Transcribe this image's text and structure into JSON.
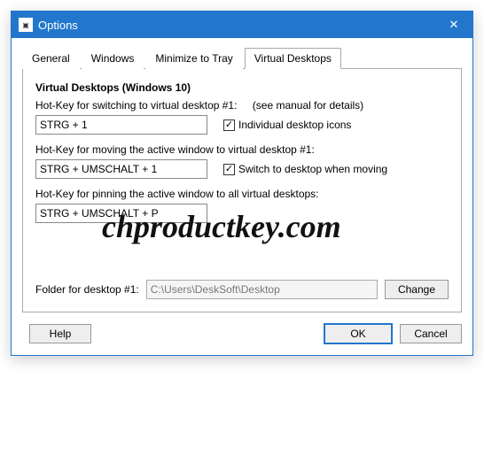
{
  "window": {
    "title": "Options",
    "close_glyph": "✕"
  },
  "tabs": [
    {
      "label": "General"
    },
    {
      "label": "Windows"
    },
    {
      "label": "Minimize to Tray"
    },
    {
      "label": "Virtual Desktops",
      "active": true
    }
  ],
  "panel": {
    "group_title": "Virtual Desktops (Windows 10)",
    "hotkey_switch_label": "Hot-Key for switching to virtual desktop #1:",
    "see_manual": "(see manual for details)",
    "hotkey_switch_value": "STRG + 1",
    "chk_individual_icons": "Individual desktop icons",
    "chk_individual_icons_checked": "✓",
    "hotkey_move_label": "Hot-Key for moving the active window to virtual desktop #1:",
    "hotkey_move_value": "STRG + UMSCHALT + 1",
    "chk_switch_when_moving": "Switch to desktop when moving",
    "chk_switch_when_moving_checked": "✓",
    "hotkey_pin_label": "Hot-Key for pinning the active window to all virtual desktops:",
    "hotkey_pin_value": "STRG + UMSCHALT + P",
    "folder_label": "Folder for desktop #1:",
    "folder_value": "C:\\Users\\DeskSoft\\Desktop",
    "change_btn": "Change"
  },
  "buttons": {
    "help": "Help",
    "ok": "OK",
    "cancel": "Cancel"
  },
  "watermark": "chproductkey.com"
}
